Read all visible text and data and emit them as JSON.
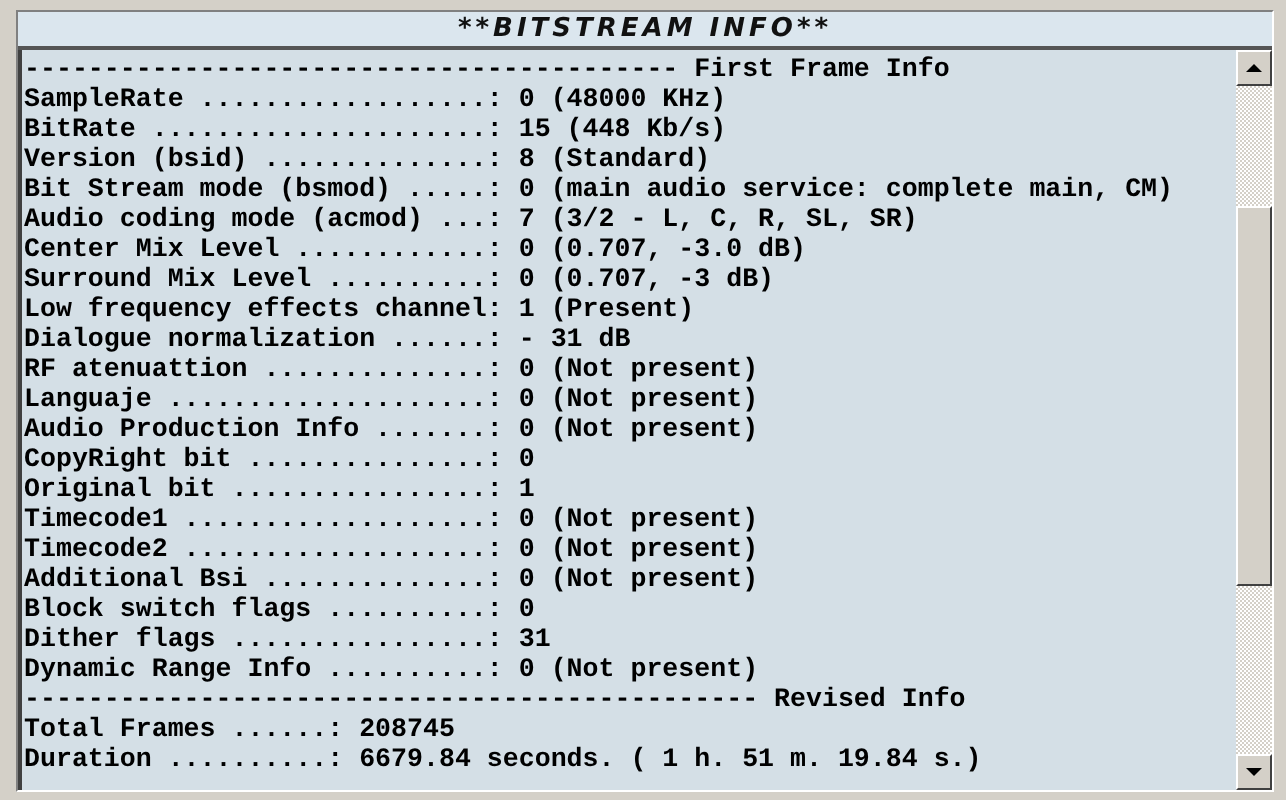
{
  "panel": {
    "title": "**BITSTREAM INFO**"
  },
  "lines": [
    "----------------------------------------- First Frame Info",
    "SampleRate ..................: 0 (48000 KHz)",
    "BitRate .....................: 15 (448 Kb/s)",
    "Version (bsid) ..............: 8 (Standard)",
    "Bit Stream mode (bsmod) .....: 0 (main audio service: complete main, CM)",
    "Audio coding mode (acmod) ...: 7 (3/2 - L, C, R, SL, SR)",
    "Center Mix Level ............: 0 (0.707, -3.0 dB)",
    "Surround Mix Level ..........: 0 (0.707, -3 dB)",
    "Low frequency effects channel: 1 (Present)",
    "Dialogue normalization ......: - 31 dB",
    "RF atenuattion ..............: 0 (Not present)",
    "Languaje ....................: 0 (Not present)",
    "Audio Production Info .......: 0 (Not present)",
    "CopyRight bit ...............: 0",
    "Original bit ................: 1",
    "Timecode1 ...................: 0 (Not present)",
    "Timecode2 ...................: 0 (Not present)",
    "Additional Bsi ..............: 0 (Not present)",
    "Block switch flags ..........: 0",
    "Dither flags ................: 31",
    "Dynamic Range Info ..........: 0 (Not present)",
    "---------------------------------------------- Revised Info",
    "Total Frames ......: 208745",
    "Duration ..........: 6679.84 seconds. ( 1 h. 51 m. 19.84 s.)"
  ]
}
